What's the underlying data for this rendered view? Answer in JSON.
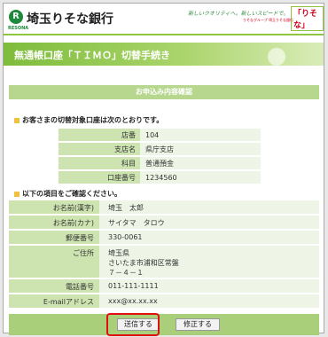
{
  "header": {
    "logo_icon": "R",
    "logo_sub": "RESONA",
    "bank_name": "埼玉りそな銀行",
    "tagline": "新しいクオリティへ。新しいスピードで。",
    "brand": "「りそな」",
    "brand_note": "りそなグループ 埼玉りそな銀行"
  },
  "banner": {
    "title": "無通帳口座「ＴＩＭＯ」切替手続き"
  },
  "panel": {
    "title": "お申込み内容確認"
  },
  "account_section": {
    "heading": "お客さまの切替対象口座は次のとおりです。",
    "rows": [
      {
        "label": "店番",
        "value": "104"
      },
      {
        "label": "支店名",
        "value": "県庁支店"
      },
      {
        "label": "科目",
        "value": "普通預金"
      },
      {
        "label": "口座番号",
        "value": "1234560"
      }
    ]
  },
  "details_section": {
    "heading": "以下の項目をご確認ください。",
    "rows": [
      {
        "label": "お名前(漢字)",
        "value": "埼玉　太郎"
      },
      {
        "label": "お名前(カナ)",
        "value": "サイタマ　タロウ"
      },
      {
        "label": "郵便番号",
        "value": "330-0061"
      },
      {
        "label": "ご住所",
        "line1": "埼玉県",
        "line2": "さいたま市浦和区常盤",
        "line3": "７－４－１"
      },
      {
        "label": "電話番号",
        "value": "011-111-1111"
      },
      {
        "label": "E-mailアドレス",
        "value": "xxx@xx.xx.xx"
      }
    ]
  },
  "buttons": {
    "send": "送信する",
    "fix": "修正する"
  },
  "colors": {
    "brand_green": "#8fc640",
    "highlight": "#e01010"
  }
}
